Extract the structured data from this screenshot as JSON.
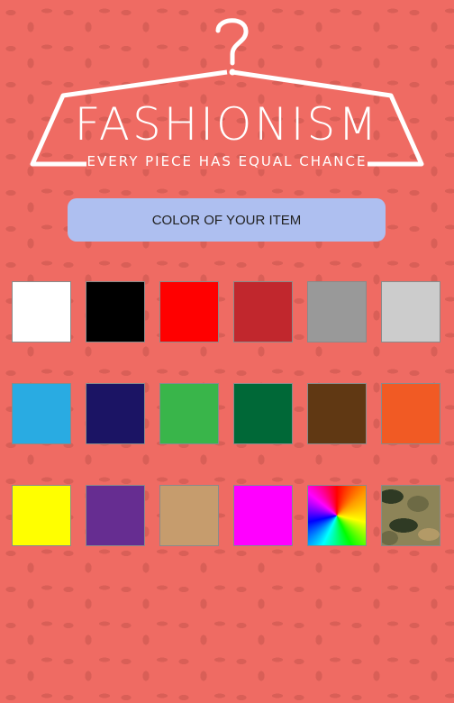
{
  "brand": {
    "name": "FASHIONISM",
    "tagline": "EVERY PIECE HAS EQUAL CHANCE"
  },
  "header": {
    "title": "COLOR OF YOUR ITEM"
  },
  "colors": [
    {
      "name": "white",
      "hex": "#ffffff"
    },
    {
      "name": "black",
      "hex": "#000000"
    },
    {
      "name": "red",
      "hex": "#ff0000"
    },
    {
      "name": "dark-red",
      "hex": "#c1272d"
    },
    {
      "name": "gray",
      "hex": "#999999"
    },
    {
      "name": "light-gray",
      "hex": "#cccccc"
    },
    {
      "name": "sky-blue",
      "hex": "#29abe2"
    },
    {
      "name": "navy",
      "hex": "#1b1464"
    },
    {
      "name": "green",
      "hex": "#39b54a"
    },
    {
      "name": "dark-green",
      "hex": "#006837"
    },
    {
      "name": "brown",
      "hex": "#603813"
    },
    {
      "name": "orange",
      "hex": "#f15a24"
    },
    {
      "name": "yellow",
      "hex": "#ffff00"
    },
    {
      "name": "purple",
      "hex": "#662d91"
    },
    {
      "name": "tan",
      "hex": "#c69c6d"
    },
    {
      "name": "magenta",
      "hex": "#ff00ff"
    },
    {
      "name": "multicolor",
      "hex": "#ff9900"
    },
    {
      "name": "camouflage",
      "hex": "#8d8458"
    }
  ]
}
